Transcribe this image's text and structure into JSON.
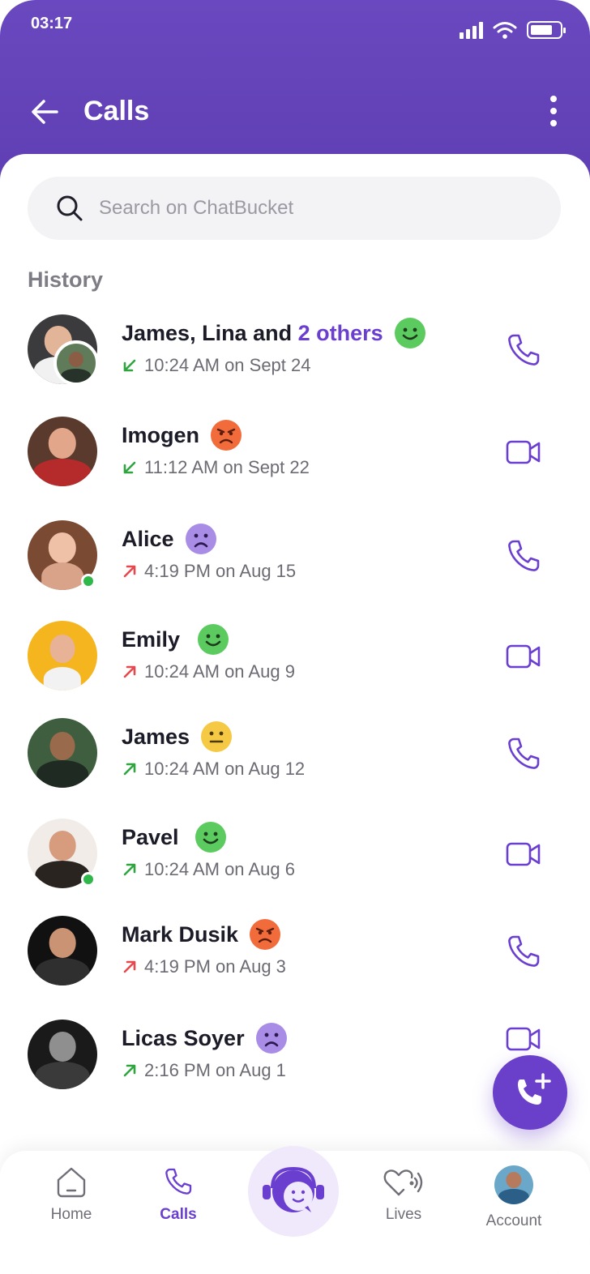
{
  "status_bar": {
    "time": "03:17"
  },
  "header": {
    "title": "Calls"
  },
  "search": {
    "placeholder": "Search on ChatBucket"
  },
  "history": {
    "title": "History",
    "calls": [
      {
        "name": "James, Lina and",
        "name_highlight": "2 others",
        "mood": "happy",
        "direction": "incoming",
        "meta": "10:24 AM on Sept 24",
        "call_type": "voice",
        "online": false
      },
      {
        "name": "Imogen",
        "name_highlight": "",
        "mood": "angry",
        "direction": "incoming",
        "meta": "11:12 AM on Sept 22",
        "call_type": "video",
        "online": false
      },
      {
        "name": "Alice",
        "name_highlight": "",
        "mood": "sad",
        "direction": "outgoing-missed",
        "meta": "4:19 PM on Aug 15",
        "call_type": "voice",
        "online": true
      },
      {
        "name": "Emily",
        "name_highlight": "",
        "mood": "happy",
        "direction": "outgoing-missed",
        "meta": "10:24 AM on  Aug 9",
        "call_type": "video",
        "online": false
      },
      {
        "name": "James",
        "name_highlight": "",
        "mood": "neutral",
        "direction": "outgoing",
        "meta": "10:24 AM on Aug 12",
        "call_type": "voice",
        "online": false
      },
      {
        "name": "Pavel",
        "name_highlight": "",
        "mood": "happy",
        "direction": "outgoing",
        "meta": "10:24 AM on  Aug 6",
        "call_type": "video",
        "online": true
      },
      {
        "name": "Mark Dusik",
        "name_highlight": "",
        "mood": "angry",
        "direction": "outgoing-missed",
        "meta": "4:19 PM on Aug 3",
        "call_type": "voice",
        "online": false
      },
      {
        "name": "Licas Soyer",
        "name_highlight": "",
        "mood": "sad",
        "direction": "outgoing",
        "meta": "2:16 PM on Aug 1",
        "call_type": "video",
        "online": false
      }
    ]
  },
  "tabbar": {
    "home": "Home",
    "calls": "Calls",
    "lives": "Lives",
    "account": "Account"
  },
  "colors": {
    "primary": "#6a3fd0",
    "header": "#6a48bf",
    "incoming": "#2fa53f",
    "outgoing": "#2fa53f",
    "missed": "#e5484d",
    "happy": "#5ccb5f",
    "angry": "#f26b3a",
    "sad": "#a98ce6",
    "neutral": "#f6c945"
  },
  "icons": {
    "back": "arrow-left-icon",
    "more": "more-vertical-icon",
    "search": "search-icon",
    "voice": "phone-icon",
    "video": "video-camera-icon",
    "fab": "add-call-icon"
  }
}
